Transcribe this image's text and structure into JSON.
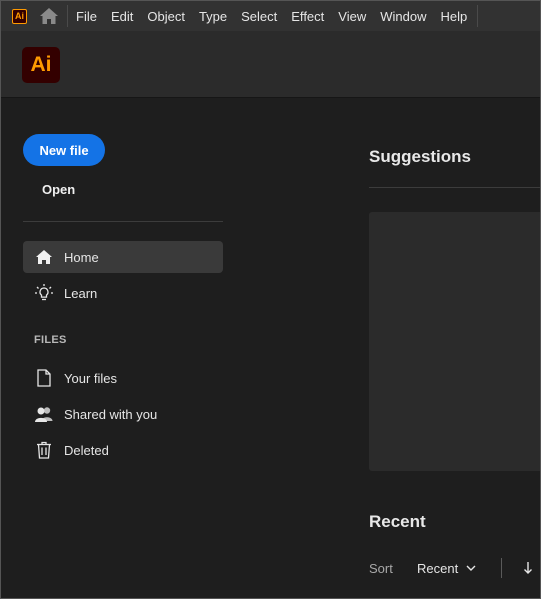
{
  "menubar": {
    "app_icon_label": "Ai",
    "home_icon": "home-icon",
    "items": [
      "File",
      "Edit",
      "Object",
      "Type",
      "Select",
      "Effect",
      "View",
      "Window",
      "Help"
    ]
  },
  "header": {
    "logo_label": "Ai"
  },
  "sidebar": {
    "new_file_label": "New file",
    "open_label": "Open",
    "nav": [
      {
        "label": "Home",
        "icon": "home-icon"
      },
      {
        "label": "Learn",
        "icon": "lightbulb-icon"
      }
    ],
    "files_section_label": "FILES",
    "files": [
      {
        "label": "Your files",
        "icon": "document-icon"
      },
      {
        "label": "Shared with you",
        "icon": "users-icon"
      },
      {
        "label": "Deleted",
        "icon": "trash-icon"
      }
    ]
  },
  "main": {
    "suggestions_title": "Suggestions",
    "recent_title": "Recent",
    "sort_label": "Sort",
    "sort_value": "Recent"
  },
  "colors": {
    "accent": "#1473e6",
    "ai_brand": "#ff9a00",
    "ai_bg": "#330000"
  }
}
